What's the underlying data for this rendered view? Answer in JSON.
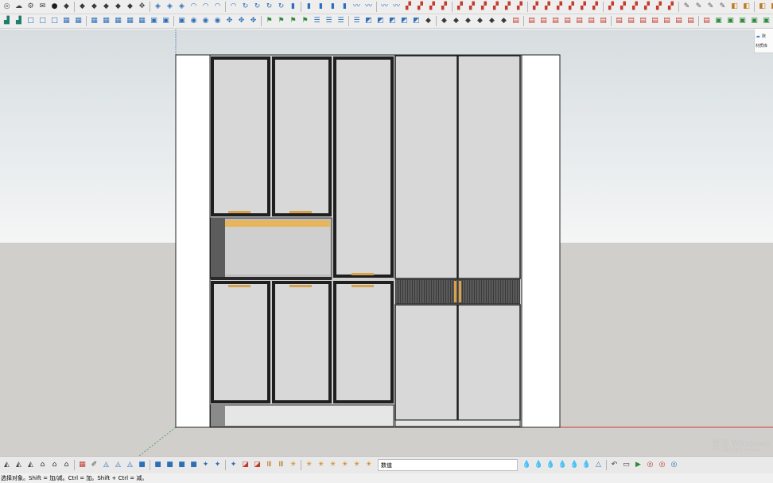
{
  "colors": {
    "toolbar_bg": "#eeeeee",
    "sky_top": "#d7dde0",
    "sky_bottom": "#f4f6f6",
    "ground": "#d1cfcb",
    "door": "#d8d8d8",
    "frame": "#1f1f1f",
    "side_panel": "#ffffff",
    "handle": "#d8a24a",
    "led_strip": "#e8b55a",
    "hidden_gap": "#3a3a3a",
    "axis_red": "#cc3b3b",
    "axis_green": "#5aa35a",
    "axis_blue": "#6d8fcf"
  },
  "toolbar_top_1": [
    {
      "icon": "select-icon",
      "glyph": "◎",
      "color": "#555555"
    },
    {
      "icon": "cloud-icon",
      "glyph": "☁",
      "color": "#444444"
    },
    {
      "icon": "gear-icon",
      "glyph": "⚙",
      "color": "#444444"
    },
    {
      "icon": "mail-icon",
      "glyph": "✉",
      "color": "#333333"
    },
    {
      "icon": "info-icon",
      "glyph": "●",
      "color": "#1e1e1e"
    },
    {
      "icon": "component-icon",
      "glyph": "◆",
      "color": "#3a3a3a"
    },
    {
      "icon": "component-icon",
      "glyph": "◆",
      "color": "#3a3a3a"
    },
    {
      "icon": "component-icon",
      "glyph": "◆",
      "color": "#3a3a3a"
    },
    {
      "icon": "component-icon",
      "glyph": "◆",
      "color": "#3a3a3a"
    },
    {
      "icon": "component-icon",
      "glyph": "◆",
      "color": "#3a3a3a"
    },
    {
      "icon": "component-icon",
      "glyph": "◆",
      "color": "#3a3a3a"
    },
    {
      "icon": "move-icon",
      "glyph": "✥",
      "color": "#444444"
    },
    {
      "icon": "paint-icon",
      "glyph": "◈",
      "color": "#2d6fb8"
    },
    {
      "icon": "paint-icon",
      "glyph": "◈",
      "color": "#2d6fb8"
    },
    {
      "icon": "paint-icon",
      "glyph": "◈",
      "color": "#2d6fb8"
    },
    {
      "icon": "shape-icon",
      "glyph": "◠",
      "color": "#2d6fb8"
    },
    {
      "icon": "shape-icon",
      "glyph": "◠",
      "color": "#2d6fb8"
    },
    {
      "icon": "shape-icon",
      "glyph": "◠",
      "color": "#2d6fb8"
    },
    {
      "icon": "shape-icon",
      "glyph": "◠",
      "color": "#2d6fb8"
    },
    {
      "icon": "rotate-icon",
      "glyph": "↻",
      "color": "#2d6fb8"
    },
    {
      "icon": "rotate-icon",
      "glyph": "↻",
      "color": "#2d6fb8"
    },
    {
      "icon": "rotate-icon",
      "glyph": "↻",
      "color": "#2d6fb8"
    },
    {
      "icon": "rotate-icon",
      "glyph": "↻",
      "color": "#2d6fb8"
    },
    {
      "icon": "panel-icon",
      "glyph": "▮",
      "color": "#2d6fb8"
    },
    {
      "icon": "panel-icon",
      "glyph": "▮",
      "color": "#2d6fb8"
    },
    {
      "icon": "panel-icon",
      "glyph": "▮",
      "color": "#2d6fb8"
    },
    {
      "icon": "panel-icon",
      "glyph": "▮",
      "color": "#2d6fb8"
    },
    {
      "icon": "panel-icon",
      "glyph": "▮",
      "color": "#2d6fb8"
    },
    {
      "icon": "curve-icon",
      "glyph": "〰",
      "color": "#2d6fb8"
    },
    {
      "icon": "curve-icon",
      "glyph": "〰",
      "color": "#2d6fb8"
    },
    {
      "icon": "curve-icon",
      "glyph": "〰",
      "color": "#2d6fb8"
    },
    {
      "icon": "curve-icon",
      "glyph": "〰",
      "color": "#2d6fb8"
    },
    {
      "icon": "tool-icon",
      "glyph": "▞",
      "color": "#c43a2c"
    },
    {
      "icon": "tool-icon",
      "glyph": "▞",
      "color": "#c43a2c"
    },
    {
      "icon": "tool-icon",
      "glyph": "▞",
      "color": "#c43a2c"
    },
    {
      "icon": "tool-icon",
      "glyph": "▞",
      "color": "#c43a2c"
    },
    {
      "icon": "tool-icon",
      "glyph": "▞",
      "color": "#c43a2c"
    },
    {
      "icon": "tool-icon",
      "glyph": "▞",
      "color": "#c43a2c"
    },
    {
      "icon": "tool-icon",
      "glyph": "▞",
      "color": "#c43a2c"
    },
    {
      "icon": "tool-icon",
      "glyph": "▞",
      "color": "#c43a2c"
    },
    {
      "icon": "tool-icon",
      "glyph": "▞",
      "color": "#c43a2c"
    },
    {
      "icon": "tool-icon",
      "glyph": "▞",
      "color": "#c43a2c"
    },
    {
      "icon": "tool-icon",
      "glyph": "▞",
      "color": "#c43a2c"
    },
    {
      "icon": "tool-icon",
      "glyph": "▞",
      "color": "#c43a2c"
    },
    {
      "icon": "tool-icon",
      "glyph": "▞",
      "color": "#c43a2c"
    },
    {
      "icon": "tool-icon",
      "glyph": "▞",
      "color": "#c43a2c"
    },
    {
      "icon": "tool-icon",
      "glyph": "▞",
      "color": "#c43a2c"
    },
    {
      "icon": "tool-icon",
      "glyph": "▞",
      "color": "#c43a2c"
    },
    {
      "icon": "tool-icon",
      "glyph": "▞",
      "color": "#c43a2c"
    },
    {
      "icon": "tool-icon",
      "glyph": "▞",
      "color": "#c43a2c"
    },
    {
      "icon": "tool-icon",
      "glyph": "▞",
      "color": "#c43a2c"
    },
    {
      "icon": "tool-icon",
      "glyph": "▞",
      "color": "#c43a2c"
    },
    {
      "icon": "tool-icon",
      "glyph": "▞",
      "color": "#c43a2c"
    },
    {
      "icon": "tool-icon",
      "glyph": "▞",
      "color": "#c43a2c"
    },
    {
      "icon": "pencil-icon",
      "glyph": "✎",
      "color": "#555555"
    },
    {
      "icon": "pencil-icon",
      "glyph": "✎",
      "color": "#555555"
    },
    {
      "icon": "pencil-icon",
      "glyph": "✎",
      "color": "#555555"
    },
    {
      "icon": "pencil-icon",
      "glyph": "✎",
      "color": "#555555"
    },
    {
      "icon": "box-icon",
      "glyph": "◧",
      "color": "#c07a1f"
    },
    {
      "icon": "box-icon",
      "glyph": "◧",
      "color": "#c07a1f"
    },
    {
      "icon": "box-icon",
      "glyph": "◧",
      "color": "#c07a1f"
    },
    {
      "icon": "box-icon",
      "glyph": "◧",
      "color": "#c07a1f"
    },
    {
      "icon": "box-icon",
      "glyph": "◧",
      "color": "#c07a1f"
    },
    {
      "icon": "box-icon",
      "glyph": "◧",
      "color": "#c07a1f"
    },
    {
      "icon": "box-icon",
      "glyph": "◧",
      "color": "#c07a1f"
    },
    {
      "icon": "box-icon",
      "glyph": "◧",
      "color": "#c07a1f"
    }
  ],
  "toolbar_top_2": [
    {
      "icon": "layout-icon",
      "glyph": "▟",
      "color": "#1f7d6a"
    },
    {
      "icon": "layout-icon",
      "glyph": "▟",
      "color": "#1f7d6a"
    },
    {
      "icon": "square-icon",
      "glyph": "□",
      "color": "#2d6fb8"
    },
    {
      "icon": "square-icon",
      "glyph": "□",
      "color": "#2d6fb8"
    },
    {
      "icon": "square-icon",
      "glyph": "□",
      "color": "#2d6fb8"
    },
    {
      "icon": "grid-icon",
      "glyph": "▦",
      "color": "#2d6fb8"
    },
    {
      "icon": "grid-icon",
      "glyph": "▦",
      "color": "#2d6fb8"
    },
    {
      "icon": "grid-icon",
      "glyph": "▦",
      "color": "#2d6fb8"
    },
    {
      "icon": "grid-icon",
      "glyph": "▦",
      "color": "#2d6fb8"
    },
    {
      "icon": "grid-icon",
      "glyph": "▦",
      "color": "#2d6fb8"
    },
    {
      "icon": "grid-icon",
      "glyph": "▦",
      "color": "#2d6fb8"
    },
    {
      "icon": "grid-icon",
      "glyph": "▦",
      "color": "#2d6fb8"
    },
    {
      "icon": "square-icon",
      "glyph": "▣",
      "color": "#2d6fb8"
    },
    {
      "icon": "square-icon",
      "glyph": "▣",
      "color": "#2d6fb8"
    },
    {
      "icon": "square-icon",
      "glyph": "▣",
      "color": "#2d6fb8"
    },
    {
      "icon": "circle-icon",
      "glyph": "◉",
      "color": "#2d6fb8"
    },
    {
      "icon": "circle-icon",
      "glyph": "◉",
      "color": "#2d6fb8"
    },
    {
      "icon": "circle-icon",
      "glyph": "◉",
      "color": "#2d6fb8"
    },
    {
      "icon": "move-icon",
      "glyph": "✥",
      "color": "#2d6fb8"
    },
    {
      "icon": "move-icon",
      "glyph": "✥",
      "color": "#2d6fb8"
    },
    {
      "icon": "move-icon",
      "glyph": "✥",
      "color": "#2d6fb8"
    },
    {
      "icon": "flag-icon",
      "glyph": "⚑",
      "color": "#2f8a3a"
    },
    {
      "icon": "flag-icon",
      "glyph": "⚑",
      "color": "#2f8a3a"
    },
    {
      "icon": "flag-icon",
      "glyph": "⚑",
      "color": "#2f8a3a"
    },
    {
      "icon": "flag-icon",
      "glyph": "⚑",
      "color": "#2f8a3a"
    },
    {
      "icon": "list-icon",
      "glyph": "☰",
      "color": "#2d6fb8"
    },
    {
      "icon": "list-icon",
      "glyph": "☰",
      "color": "#2d6fb8"
    },
    {
      "icon": "list-icon",
      "glyph": "☰",
      "color": "#2d6fb8"
    },
    {
      "icon": "list-icon",
      "glyph": "☰",
      "color": "#2d6fb8"
    },
    {
      "icon": "chart-icon",
      "glyph": "◩",
      "color": "#2d6fb8"
    },
    {
      "icon": "chart-icon",
      "glyph": "◩",
      "color": "#2d6fb8"
    },
    {
      "icon": "chart-icon",
      "glyph": "◩",
      "color": "#2d6fb8"
    },
    {
      "icon": "chart-icon",
      "glyph": "◩",
      "color": "#2d6fb8"
    },
    {
      "icon": "chart-icon",
      "glyph": "◩",
      "color": "#2d6fb8"
    },
    {
      "icon": "box-icon",
      "glyph": "◆",
      "color": "#3a3a3a"
    },
    {
      "icon": "box-icon",
      "glyph": "◆",
      "color": "#3a3a3a"
    },
    {
      "icon": "box-icon",
      "glyph": "◆",
      "color": "#3a3a3a"
    },
    {
      "icon": "box-icon",
      "glyph": "◆",
      "color": "#3a3a3a"
    },
    {
      "icon": "box-icon",
      "glyph": "◆",
      "color": "#3a3a3a"
    },
    {
      "icon": "box-icon",
      "glyph": "◆",
      "color": "#3a3a3a"
    },
    {
      "icon": "box-icon",
      "glyph": "◆",
      "color": "#3a3a3a"
    },
    {
      "icon": "frame-icon",
      "glyph": "▤",
      "color": "#c43a2c"
    },
    {
      "icon": "frame-icon",
      "glyph": "▤",
      "color": "#c43a2c"
    },
    {
      "icon": "frame-icon",
      "glyph": "▤",
      "color": "#c43a2c"
    },
    {
      "icon": "frame-icon",
      "glyph": "▤",
      "color": "#c43a2c"
    },
    {
      "icon": "frame-icon",
      "glyph": "▤",
      "color": "#c43a2c"
    },
    {
      "icon": "frame-icon",
      "glyph": "▤",
      "color": "#c43a2c"
    },
    {
      "icon": "frame-icon",
      "glyph": "▤",
      "color": "#c43a2c"
    },
    {
      "icon": "frame-icon",
      "glyph": "▤",
      "color": "#c43a2c"
    },
    {
      "icon": "frame-icon",
      "glyph": "▤",
      "color": "#c43a2c"
    },
    {
      "icon": "frame-icon",
      "glyph": "▤",
      "color": "#c43a2c"
    },
    {
      "icon": "frame-icon",
      "glyph": "▤",
      "color": "#c43a2c"
    },
    {
      "icon": "frame-icon",
      "glyph": "▤",
      "color": "#c43a2c"
    },
    {
      "icon": "frame-icon",
      "glyph": "▤",
      "color": "#c43a2c"
    },
    {
      "icon": "frame-icon",
      "glyph": "▤",
      "color": "#c43a2c"
    },
    {
      "icon": "frame-icon",
      "glyph": "▤",
      "color": "#c43a2c"
    },
    {
      "icon": "frame-icon",
      "glyph": "▤",
      "color": "#c43a2c"
    },
    {
      "icon": "check-icon",
      "glyph": "▣",
      "color": "#2f8a3a"
    },
    {
      "icon": "check-icon",
      "glyph": "▣",
      "color": "#2f8a3a"
    },
    {
      "icon": "check-icon",
      "glyph": "▣",
      "color": "#2f8a3a"
    },
    {
      "icon": "check-icon",
      "glyph": "▣",
      "color": "#2f8a3a"
    },
    {
      "icon": "check-icon",
      "glyph": "▣",
      "color": "#2f8a3a"
    },
    {
      "icon": "check-icon",
      "glyph": "▣",
      "color": "#2f8a3a"
    },
    {
      "icon": "check-icon",
      "glyph": "▣",
      "color": "#2f8a3a"
    },
    {
      "icon": "check-icon",
      "glyph": "▣",
      "color": "#2f8a3a"
    }
  ],
  "toolbar_bottom": [
    {
      "icon": "layer-icon",
      "glyph": "◭",
      "color": "#444444"
    },
    {
      "icon": "layer-icon",
      "glyph": "◭",
      "color": "#444444"
    },
    {
      "icon": "layer-icon",
      "glyph": "◭",
      "color": "#444444"
    },
    {
      "icon": "home-icon",
      "glyph": "⌂",
      "color": "#333333"
    },
    {
      "icon": "home-icon",
      "glyph": "⌂",
      "color": "#333333"
    },
    {
      "icon": "home-icon",
      "glyph": "⌂",
      "color": "#333333"
    },
    {
      "icon": "table-icon",
      "glyph": "▦",
      "color": "#c43a2c"
    },
    {
      "icon": "tag-icon",
      "glyph": "✐",
      "color": "#444444"
    },
    {
      "icon": "style-icon",
      "glyph": "◬",
      "color": "#2d6fb8"
    },
    {
      "icon": "style-icon",
      "glyph": "◬",
      "color": "#2d6fb8"
    },
    {
      "icon": "style-icon",
      "glyph": "◬",
      "color": "#2d6fb8"
    },
    {
      "icon": "view-icon",
      "glyph": "■",
      "color": "#2d6fb8"
    },
    {
      "icon": "view-icon",
      "glyph": "■",
      "color": "#2d6fb8"
    },
    {
      "icon": "view-icon",
      "glyph": "■",
      "color": "#2d6fb8"
    },
    {
      "icon": "view-icon",
      "glyph": "■",
      "color": "#2d6fb8"
    },
    {
      "icon": "view-icon",
      "glyph": "■",
      "color": "#2d6fb8"
    },
    {
      "icon": "wand-icon",
      "glyph": "✦",
      "color": "#2d6fb8"
    },
    {
      "icon": "wand-icon",
      "glyph": "✦",
      "color": "#2d6fb8"
    },
    {
      "icon": "wand-icon",
      "glyph": "✦",
      "color": "#2d6fb8"
    },
    {
      "icon": "eraser-icon",
      "glyph": "◪",
      "color": "#c43a2c"
    },
    {
      "icon": "eraser-icon",
      "glyph": "◪",
      "color": "#c43a2c"
    },
    {
      "icon": "bars-icon",
      "glyph": "Ⅲ",
      "color": "#c07a1f"
    },
    {
      "icon": "bars-icon",
      "glyph": "Ⅲ",
      "color": "#c07a1f"
    },
    {
      "icon": "sun-icon",
      "glyph": "☀",
      "color": "#d08a1c"
    },
    {
      "icon": "sun-icon",
      "glyph": "☀",
      "color": "#d08a1c"
    },
    {
      "icon": "sun-icon",
      "glyph": "☀",
      "color": "#d08a1c"
    },
    {
      "icon": "sun-icon",
      "glyph": "☀",
      "color": "#d08a1c"
    },
    {
      "icon": "sun-icon",
      "glyph": "☀",
      "color": "#d08a1c"
    },
    {
      "icon": "sun-icon",
      "glyph": "☀",
      "color": "#d08a1c"
    },
    {
      "icon": "sun-icon",
      "glyph": "☀",
      "color": "#d08a1c"
    }
  ],
  "toolbar_bottom_right": [
    {
      "icon": "drop-icon",
      "glyph": "💧",
      "color": "#2d6fb8"
    },
    {
      "icon": "drop-icon",
      "glyph": "💧",
      "color": "#2d6fb8"
    },
    {
      "icon": "drop-icon",
      "glyph": "💧",
      "color": "#2d6fb8"
    },
    {
      "icon": "drop-icon",
      "glyph": "💧",
      "color": "#2d6fb8"
    },
    {
      "icon": "drop-icon",
      "glyph": "💧",
      "color": "#2d6fb8"
    },
    {
      "icon": "drop-icon",
      "glyph": "💧",
      "color": "#2d6fb8"
    },
    {
      "icon": "triangle-icon",
      "glyph": "△",
      "color": "#2d6fb8"
    },
    {
      "icon": "undo-icon",
      "glyph": "↶",
      "color": "#444444"
    },
    {
      "icon": "screen-icon",
      "glyph": "▭",
      "color": "#444444"
    },
    {
      "icon": "play-icon",
      "glyph": "▶",
      "color": "#2f8a3a"
    },
    {
      "icon": "record-icon",
      "glyph": "◎",
      "color": "#c43a2c"
    },
    {
      "icon": "record-icon",
      "glyph": "◎",
      "color": "#c43a2c"
    },
    {
      "icon": "record-icon",
      "glyph": "◎",
      "color": "#2d6fb8"
    }
  ],
  "measurements_label": "数值",
  "status_text": "选择对象。Shift = 加/减。Ctrl = 加。Shift + Ctrl = 减。",
  "right_panel": {
    "line1": "默",
    "line2": "材质库"
  },
  "watermark": {
    "line1": "激活 Windows",
    "line2": "转到\"设置\"以激活 Windows。"
  }
}
